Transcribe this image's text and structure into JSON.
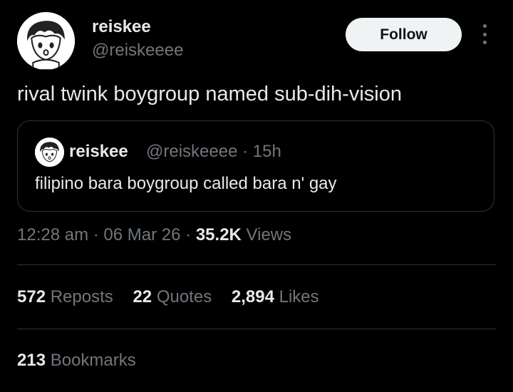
{
  "author": {
    "name": "reiskee",
    "handle": "@reiskeeee",
    "avatar_icon": "cartoon-boy-avatar-icon"
  },
  "follow_label": "Follow",
  "more_icon": "more-vertical-icon",
  "tweet_text": "rival twink boygroup named sub-dih-vision",
  "quote": {
    "name": "reiskee",
    "meta": "@reiskeeee · 15h",
    "text": "filipino bara boygroup called bara n' gay"
  },
  "meta": {
    "time": "12:28 am",
    "date": "06 Mar 26",
    "views_count": "35.2K",
    "views_label": "Views"
  },
  "stats": {
    "reposts_count": "572",
    "reposts_label": "Reposts",
    "quotes_count": "22",
    "quotes_label": "Quotes",
    "likes_count": "2,894",
    "likes_label": "Likes",
    "bookmarks_count": "213",
    "bookmarks_label": "Bookmarks"
  },
  "colors": {
    "background": "#000000",
    "text": "#e7e9ea",
    "muted": "#71767b",
    "border": "#2f3336",
    "button_bg": "#eff3f4"
  }
}
